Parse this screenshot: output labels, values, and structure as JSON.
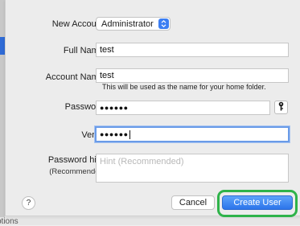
{
  "form": {
    "new_account_label": "New Account:",
    "account_type": "Administrator",
    "full_name_label": "Full Name:",
    "full_name_value": "test",
    "account_name_label": "Account Name:",
    "account_name_value": "test",
    "account_name_hint": "This will be used as the name for your home folder.",
    "password_label": "Password:",
    "password_masked": "●●●●●●",
    "verify_label": "Verify:",
    "verify_masked": "●●●●●●",
    "password_hint_label": "Password hint:",
    "password_hint_sublabel": "(Recommended)",
    "password_hint_placeholder": "Hint (Recommended)"
  },
  "buttons": {
    "help": "?",
    "cancel": "Cancel",
    "create_user": "Create User"
  },
  "background": {
    "bottom_fragment": "ptions"
  },
  "colors": {
    "accent": "#2b74ea",
    "highlight": "#2fb34a",
    "focus": "#6a9be8"
  }
}
